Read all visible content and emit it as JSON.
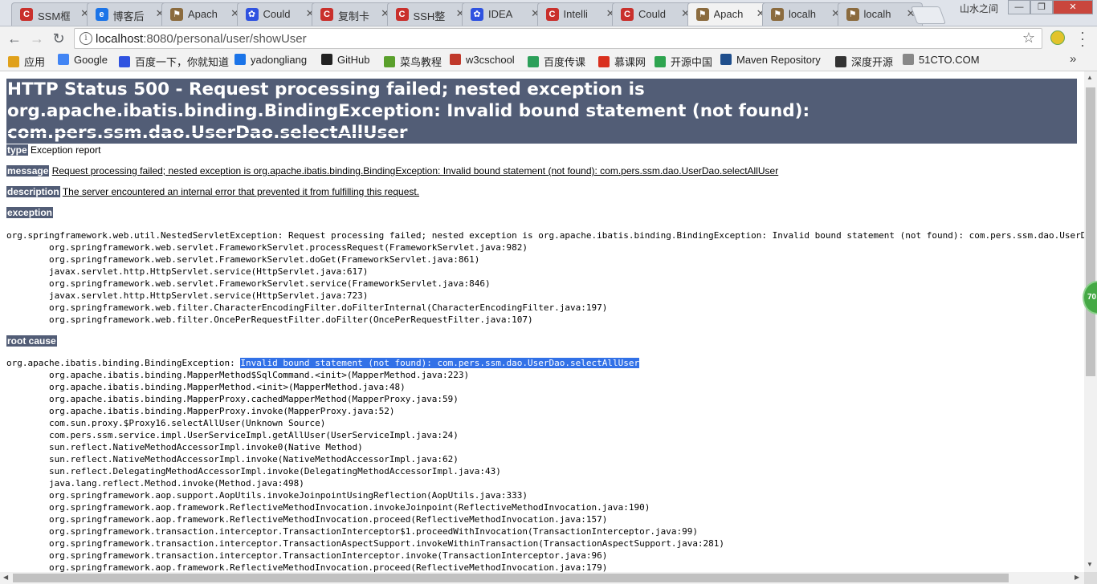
{
  "window": {
    "user_label": "山水之间",
    "controls": [
      "—",
      "❐",
      "✕"
    ]
  },
  "tabs": [
    {
      "title": "SSM框",
      "icon_color": "#c9302c",
      "icon_glyph": "C"
    },
    {
      "title": "博客后",
      "icon_color": "#1b74e8",
      "icon_glyph": "e"
    },
    {
      "title": "Apach",
      "icon_color": "#8b6b3e",
      "icon_glyph": "⚑"
    },
    {
      "title": "Could",
      "icon_color": "#2f52e0",
      "icon_glyph": "✿"
    },
    {
      "title": "复制卡",
      "icon_color": "#c9302c",
      "icon_glyph": "C"
    },
    {
      "title": "SSH整",
      "icon_color": "#c9302c",
      "icon_glyph": "C"
    },
    {
      "title": "IDEA",
      "icon_color": "#2f52e0",
      "icon_glyph": "✿"
    },
    {
      "title": "Intelli",
      "icon_color": "#c9302c",
      "icon_glyph": "C"
    },
    {
      "title": "Could",
      "icon_color": "#c9302c",
      "icon_glyph": "C"
    },
    {
      "title": "Apach",
      "icon_color": "#8b6b3e",
      "icon_glyph": "⚑",
      "active": true
    },
    {
      "title": "localh",
      "icon_color": "#8b6b3e",
      "icon_glyph": "⚑"
    },
    {
      "title": "localh",
      "icon_color": "#8b6b3e",
      "icon_glyph": "⚑"
    }
  ],
  "toolbar": {
    "back": "←",
    "forward": "→",
    "reload": "↻",
    "url_host": "localhost",
    "url_rest": ":8080/personal/user/showUser",
    "star": "☆"
  },
  "bookmarks": [
    {
      "label": "应用",
      "color": "#e0a11b"
    },
    {
      "label": "Google",
      "color": "#4285f4"
    },
    {
      "label": "百度一下，你就知道",
      "color": "#2f52e0"
    },
    {
      "label": "yadongliang",
      "color": "#1b74e8"
    },
    {
      "label": "GitHub",
      "color": "#222222"
    },
    {
      "label": "菜鸟教程",
      "color": "#5aa02c"
    },
    {
      "label": "w3cschool",
      "color": "#c0392b"
    },
    {
      "label": "百度传课",
      "color": "#2ca05a"
    },
    {
      "label": "慕课网",
      "color": "#d9301e"
    },
    {
      "label": "开源中国",
      "color": "#2ea44f"
    },
    {
      "label": "Maven Repository",
      "color": "#1f4e8c"
    },
    {
      "label": "深度开源",
      "color": "#333333"
    },
    {
      "label": "51CTO.COM",
      "color": "#888888"
    }
  ],
  "page": {
    "title": "HTTP Status 500 - Request processing failed; nested exception is org.apache.ibatis.binding.BindingException: Invalid bound statement (not found): com.pers.ssm.dao.UserDao.selectAllUser",
    "type_label": "type",
    "type_value": "Exception report",
    "message_label": "message",
    "message_value": "Request processing failed; nested exception is org.apache.ibatis.binding.BindingException: Invalid bound statement (not found): com.pers.ssm.dao.UserDao.selectAllUser",
    "description_label": "description",
    "description_value": "The server encountered an internal error that prevented it from fulfilling this request.",
    "exception_label": "exception",
    "exception_trace": "org.springframework.web.util.NestedServletException: Request processing failed; nested exception is org.apache.ibatis.binding.BindingException: Invalid bound statement (not found): com.pers.ssm.dao.UserDao.selectAllUser\n\torg.springframework.web.servlet.FrameworkServlet.processRequest(FrameworkServlet.java:982)\n\torg.springframework.web.servlet.FrameworkServlet.doGet(FrameworkServlet.java:861)\n\tjavax.servlet.http.HttpServlet.service(HttpServlet.java:617)\n\torg.springframework.web.servlet.FrameworkServlet.service(FrameworkServlet.java:846)\n\tjavax.servlet.http.HttpServlet.service(HttpServlet.java:723)\n\torg.springframework.web.filter.CharacterEncodingFilter.doFilterInternal(CharacterEncodingFilter.java:197)\n\torg.springframework.web.filter.OncePerRequestFilter.doFilter(OncePerRequestFilter.java:107)",
    "root_cause_label": "root cause",
    "root_cause_prefix": "org.apache.ibatis.binding.BindingException: ",
    "root_cause_selected": "Invalid bound statement (not found): com.pers.ssm.dao.UserDao.selectAllUser",
    "root_cause_trace": "\torg.apache.ibatis.binding.MapperMethod$SqlCommand.<init>(MapperMethod.java:223)\n\torg.apache.ibatis.binding.MapperMethod.<init>(MapperMethod.java:48)\n\torg.apache.ibatis.binding.MapperProxy.cachedMapperMethod(MapperProxy.java:59)\n\torg.apache.ibatis.binding.MapperProxy.invoke(MapperProxy.java:52)\n\tcom.sun.proxy.$Proxy16.selectAllUser(Unknown Source)\n\tcom.pers.ssm.service.impl.UserServiceImpl.getAllUser(UserServiceImpl.java:24)\n\tsun.reflect.NativeMethodAccessorImpl.invoke0(Native Method)\n\tsun.reflect.NativeMethodAccessorImpl.invoke(NativeMethodAccessorImpl.java:62)\n\tsun.reflect.DelegatingMethodAccessorImpl.invoke(DelegatingMethodAccessorImpl.java:43)\n\tjava.lang.reflect.Method.invoke(Method.java:498)\n\torg.springframework.aop.support.AopUtils.invokeJoinpointUsingReflection(AopUtils.java:333)\n\torg.springframework.aop.framework.ReflectiveMethodInvocation.invokeJoinpoint(ReflectiveMethodInvocation.java:190)\n\torg.springframework.aop.framework.ReflectiveMethodInvocation.proceed(ReflectiveMethodInvocation.java:157)\n\torg.springframework.transaction.interceptor.TransactionInterceptor$1.proceedWithInvocation(TransactionInterceptor.java:99)\n\torg.springframework.transaction.interceptor.TransactionAspectSupport.invokeWithinTransaction(TransactionAspectSupport.java:281)\n\torg.springframework.transaction.interceptor.TransactionInterceptor.invoke(TransactionInterceptor.java:96)\n\torg.springframework.aop.framework.ReflectiveMethodInvocation.proceed(ReflectiveMethodInvocation.java:179)"
  },
  "floating_badge": "70"
}
